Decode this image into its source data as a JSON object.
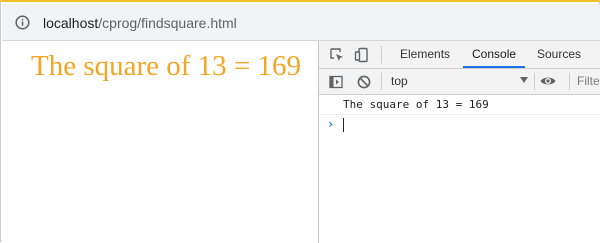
{
  "browser": {
    "url_host": "localhost",
    "url_path": "/cprog/findsquare.html"
  },
  "page": {
    "heading": "The square of 13 = 169",
    "heading_color": "#f5a524"
  },
  "devtools": {
    "tabs": [
      {
        "label": "Elements",
        "active": false
      },
      {
        "label": "Console",
        "active": true
      },
      {
        "label": "Sources",
        "active": false
      }
    ],
    "context": "top",
    "filter_placeholder": "Filter",
    "messages": [
      {
        "text": "The square of 13 = 169"
      }
    ],
    "accent_color": "#1a73e8"
  }
}
